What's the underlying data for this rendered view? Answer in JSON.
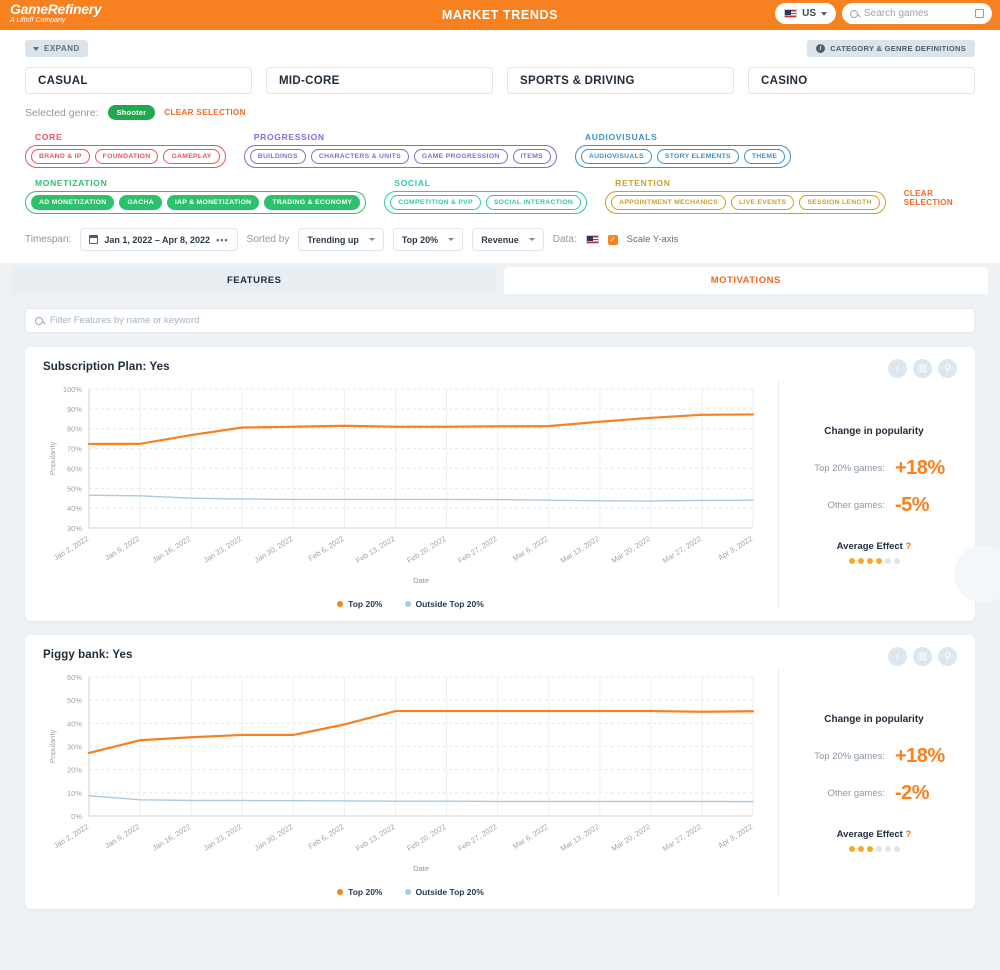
{
  "header": {
    "logo_line1": "GameRefinery",
    "logo_line2": "A Liftoff Company",
    "title": "MARKET TRENDS",
    "country": "US",
    "search_placeholder": "Search games"
  },
  "filters": {
    "expand_label": "EXPAND",
    "definitions_label": "CATEGORY & GENRE DEFINITIONS",
    "categories": [
      "CASUAL",
      "MID-CORE",
      "SPORTS & DRIVING",
      "CASINO"
    ],
    "selected_genre_label": "Selected genre:",
    "selected_genre": "Shooter",
    "clear_selection": "CLEAR SELECTION",
    "clear_selection_right": "CLEAR SELECTION",
    "groups": [
      {
        "name": "CORE",
        "color": "#e8545a",
        "chips": [
          "BRAND & IP",
          "FOUNDATION",
          "GAMEPLAY"
        ],
        "selected": false
      },
      {
        "name": "PROGRESSION",
        "color": "#7b6fd6",
        "chips": [
          "BUILDINGS",
          "CHARACTERS & UNITS",
          "GAME PROGRESSION",
          "ITEMS"
        ],
        "selected": false
      },
      {
        "name": "AUDIOVISUALS",
        "color": "#3d8fc8",
        "chips": [
          "AUDIOVISUALS",
          "STORY ELEMENTS",
          "THEME"
        ],
        "selected": false
      },
      {
        "name": "MONETIZATION",
        "color": "#2ec16b",
        "chips": [
          "AD MONETIZATION",
          "GACHA",
          "IAP & MONETIZATION",
          "TRADING & ECONOMY"
        ],
        "selected": true
      },
      {
        "name": "SOCIAL",
        "color": "#2ec9b0",
        "chips": [
          "COMPETITION & PVP",
          "SOCIAL INTERACTION"
        ],
        "selected": false
      },
      {
        "name": "RETENTION",
        "color": "#c9a227",
        "chips": [
          "APPOINTMENT MECHANICS",
          "LIVE EVENTS",
          "SESSION LENGTH"
        ],
        "selected": false
      }
    ]
  },
  "timespan": {
    "label": "Timespan:",
    "range": "Jan 1, 2022  –  Apr 8, 2022",
    "sorted_by_label": "Sorted by",
    "sort_value": "Trending up",
    "segment_value": "Top 20%",
    "metric_value": "Revenue",
    "data_label": "Data:",
    "scale_label": "Scale Y-axis"
  },
  "tabs": [
    {
      "label": "FEATURES",
      "active": true
    },
    {
      "label": "MOTIVATIONS",
      "active": false
    }
  ],
  "filter_input_placeholder": "Filter Features by name or keyword",
  "legend": {
    "top": "Top 20%",
    "outside": "Outside Top 20%"
  },
  "stats_labels": {
    "head": "Change in popularity",
    "top_label": "Top 20% games:",
    "other_label": "Other games:",
    "avg_label": "Average Effect",
    "avg_help": "?"
  },
  "colors": {
    "brand": "#f78020",
    "top20": "#f78020",
    "outside": "#adc9de",
    "accent_green": "#1fa84e"
  },
  "cards": [
    {
      "title": "Subscription Plan: Yes",
      "top_change": "+18%",
      "other_change": "-5%",
      "avg_effect_filled": 4,
      "avg_effect_total": 6
    },
    {
      "title": "Piggy bank: Yes",
      "top_change": "+18%",
      "other_change": "-2%",
      "avg_effect_filled": 3,
      "avg_effect_total": 6
    }
  ],
  "chart_data": [
    {
      "type": "line",
      "title": "Subscription Plan: Yes",
      "xlabel": "Date",
      "ylabel": "Popularity",
      "ylim": [
        30,
        100
      ],
      "yticks": [
        "30%",
        "40%",
        "50%",
        "60%",
        "70%",
        "80%",
        "90%",
        "100%"
      ],
      "grid": true,
      "legend_position": "bottom",
      "categories": [
        "Jan 2, 2022",
        "Jan 9, 2022",
        "Jan 16, 2022",
        "Jan 23, 2022",
        "Jan 30, 2022",
        "Feb 6, 2022",
        "Feb 13, 2022",
        "Feb 20, 2022",
        "Feb 27, 2022",
        "Mar 6, 2022",
        "Mar 13, 2022",
        "Mar 20, 2022",
        "Mar 27, 2022",
        "Apr 3, 2022"
      ],
      "series": [
        {
          "name": "Top 20%",
          "color": "#f78020",
          "values": [
            72.3,
            72.4,
            76.8,
            80.6,
            81.0,
            81.5,
            81.0,
            81.0,
            81.2,
            81.3,
            83.5,
            85.5,
            87.0,
            87.2
          ]
        },
        {
          "name": "Outside Top 20%",
          "color": "#adc9de",
          "values": [
            46.5,
            46.2,
            45.0,
            44.6,
            44.4,
            44.4,
            44.4,
            44.4,
            44.3,
            44.0,
            43.7,
            43.6,
            43.9,
            44.0
          ]
        }
      ]
    },
    {
      "type": "line",
      "title": "Piggy bank: Yes",
      "xlabel": "Date",
      "ylabel": "Popularity",
      "ylim": [
        0,
        60
      ],
      "yticks": [
        "0%",
        "10%",
        "20%",
        "30%",
        "40%",
        "50%",
        "60%"
      ],
      "grid": true,
      "legend_position": "bottom",
      "categories": [
        "Jan 2, 2022",
        "Jan 9, 2022",
        "Jan 16, 2022",
        "Jan 23, 2022",
        "Jan 30, 2022",
        "Feb 6, 2022",
        "Feb 13, 2022",
        "Feb 20, 2022",
        "Feb 27, 2022",
        "Mar 6, 2022",
        "Mar 13, 2022",
        "Mar 20, 2022",
        "Mar 27, 2022",
        "Apr 3, 2022"
      ],
      "series": [
        {
          "name": "Top 20%",
          "color": "#f78020",
          "values": [
            27.2,
            32.7,
            34.0,
            35.0,
            35.0,
            39.5,
            45.3,
            45.3,
            45.3,
            45.3,
            45.3,
            45.3,
            45.0,
            45.2
          ]
        },
        {
          "name": "Outside Top 20%",
          "color": "#adc9de",
          "values": [
            8.7,
            7.0,
            6.7,
            6.7,
            6.6,
            6.5,
            6.4,
            6.4,
            6.3,
            6.3,
            6.3,
            6.3,
            6.3,
            6.2
          ]
        }
      ]
    }
  ]
}
